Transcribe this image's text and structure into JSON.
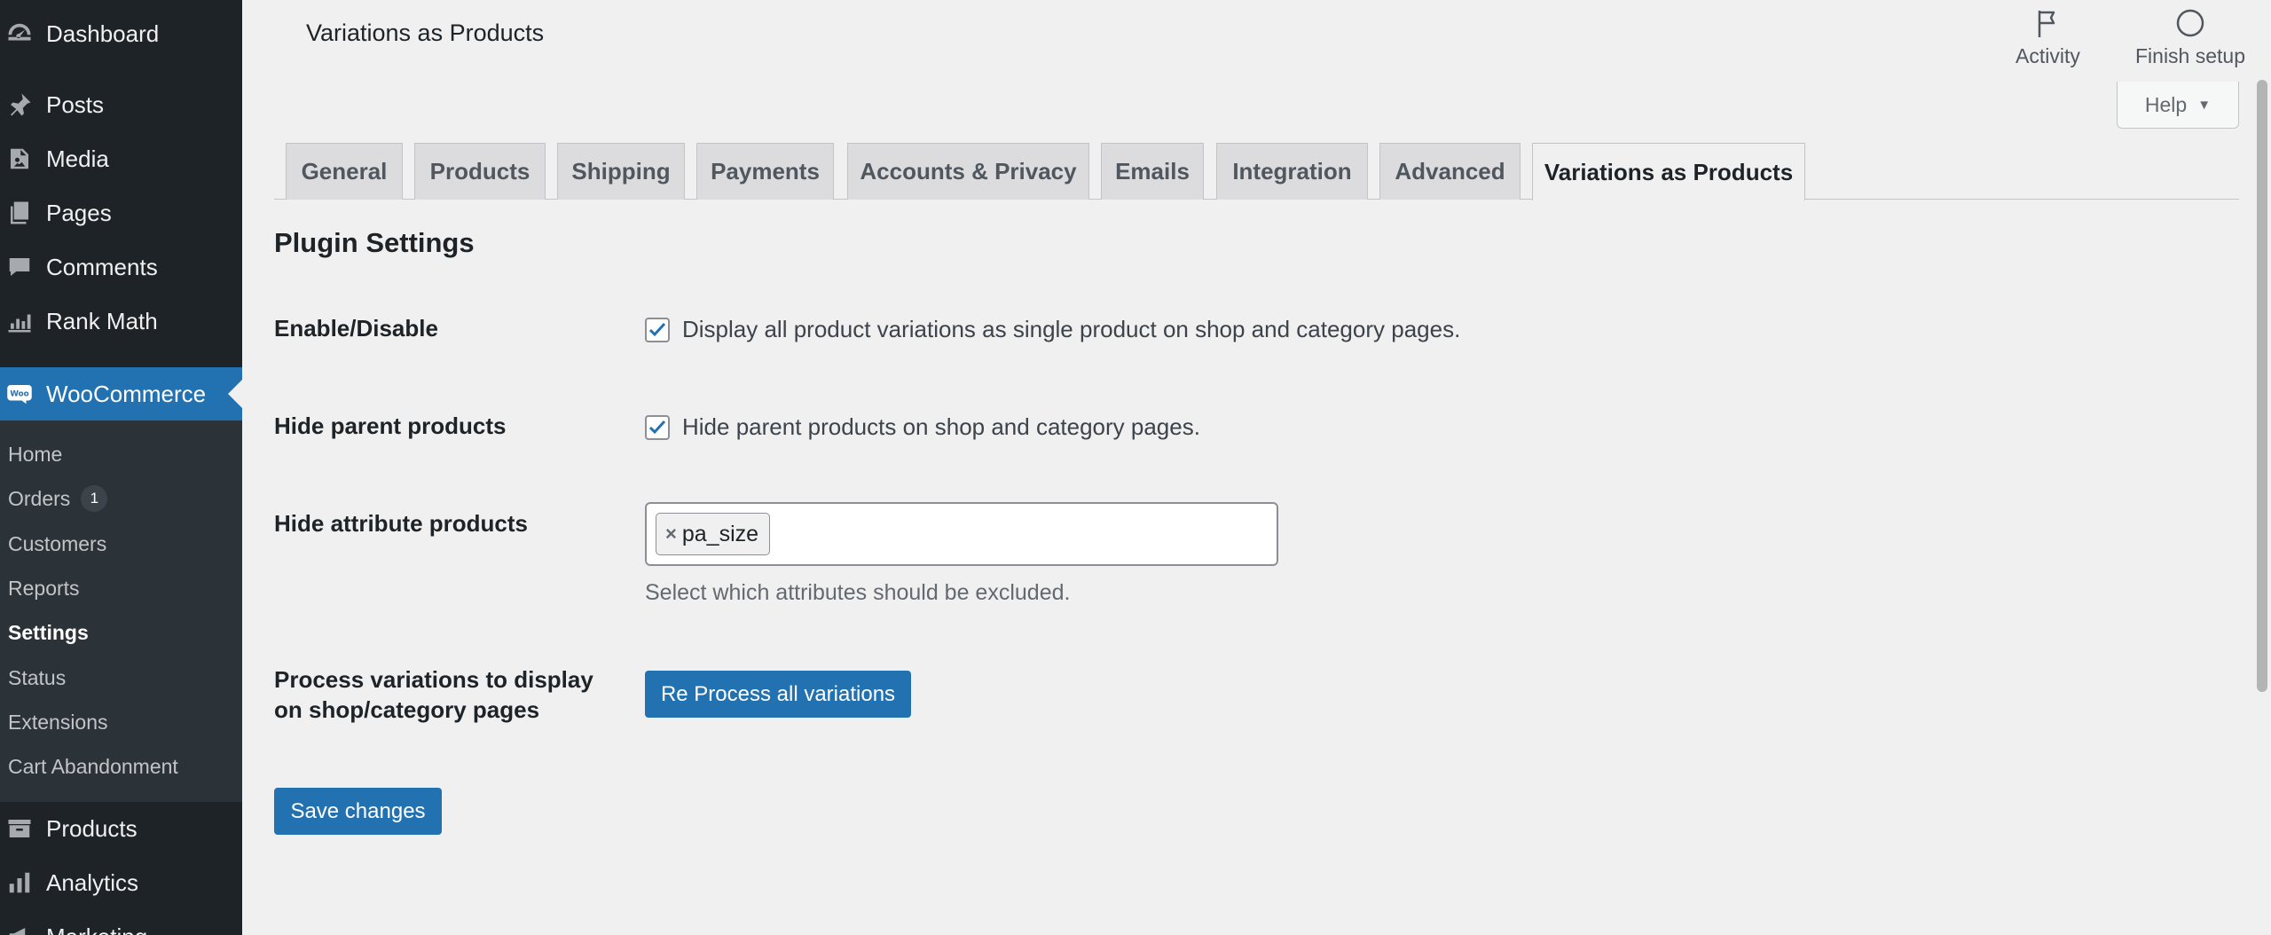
{
  "sidebar": {
    "top_items": [
      {
        "label": "Dashboard",
        "icon": "dashboard-icon"
      },
      {
        "label": "Posts",
        "icon": "pin-icon"
      },
      {
        "label": "Media",
        "icon": "media-icon"
      },
      {
        "label": "Pages",
        "icon": "pages-icon"
      },
      {
        "label": "Comments",
        "icon": "comment-icon"
      },
      {
        "label": "Rank Math",
        "icon": "chart-icon"
      }
    ],
    "woocommerce": {
      "label": "WooCommerce",
      "icon": "woo-icon"
    },
    "submenu": [
      {
        "label": "Home"
      },
      {
        "label": "Orders",
        "badge": "1"
      },
      {
        "label": "Customers"
      },
      {
        "label": "Reports"
      },
      {
        "label": "Settings"
      },
      {
        "label": "Status"
      },
      {
        "label": "Extensions"
      },
      {
        "label": "Cart Abandonment"
      }
    ],
    "bottom_items": [
      {
        "label": "Products",
        "icon": "archive-icon"
      },
      {
        "label": "Analytics",
        "icon": "bar-chart-icon"
      },
      {
        "label": "Marketing",
        "icon": "megaphone-icon"
      }
    ]
  },
  "header": {
    "title": "Variations as Products",
    "activity_label": "Activity",
    "finish_setup_label": "Finish setup",
    "help_label": "Help"
  },
  "tabs": [
    {
      "label": "General"
    },
    {
      "label": "Products"
    },
    {
      "label": "Shipping"
    },
    {
      "label": "Payments"
    },
    {
      "label": "Accounts & Privacy"
    },
    {
      "label": "Emails"
    },
    {
      "label": "Integration"
    },
    {
      "label": "Advanced"
    },
    {
      "label": "Variations as Products"
    }
  ],
  "settings": {
    "section_title": "Plugin Settings",
    "enable": {
      "label": "Enable/Disable",
      "checkbox_text": "Display all product variations as single product on shop and category pages.",
      "checked": true
    },
    "hide_parent": {
      "label": "Hide parent products",
      "checkbox_text": "Hide parent products on shop and category pages.",
      "checked": true
    },
    "hide_attribute": {
      "label": "Hide attribute products",
      "chip_remove": "×",
      "selected": "pa_size",
      "help": "Select which attributes should be excluded."
    },
    "process": {
      "label_line1": "Process variations to display",
      "label_line2": "on shop/category pages",
      "button_label": "Re Process all variations"
    },
    "save_label": "Save changes"
  },
  "colors": {
    "sidebar_bg": "#1d2327",
    "submenu_bg": "#2c3338",
    "accent": "#2271b1",
    "page_bg": "#f0f0f1"
  }
}
